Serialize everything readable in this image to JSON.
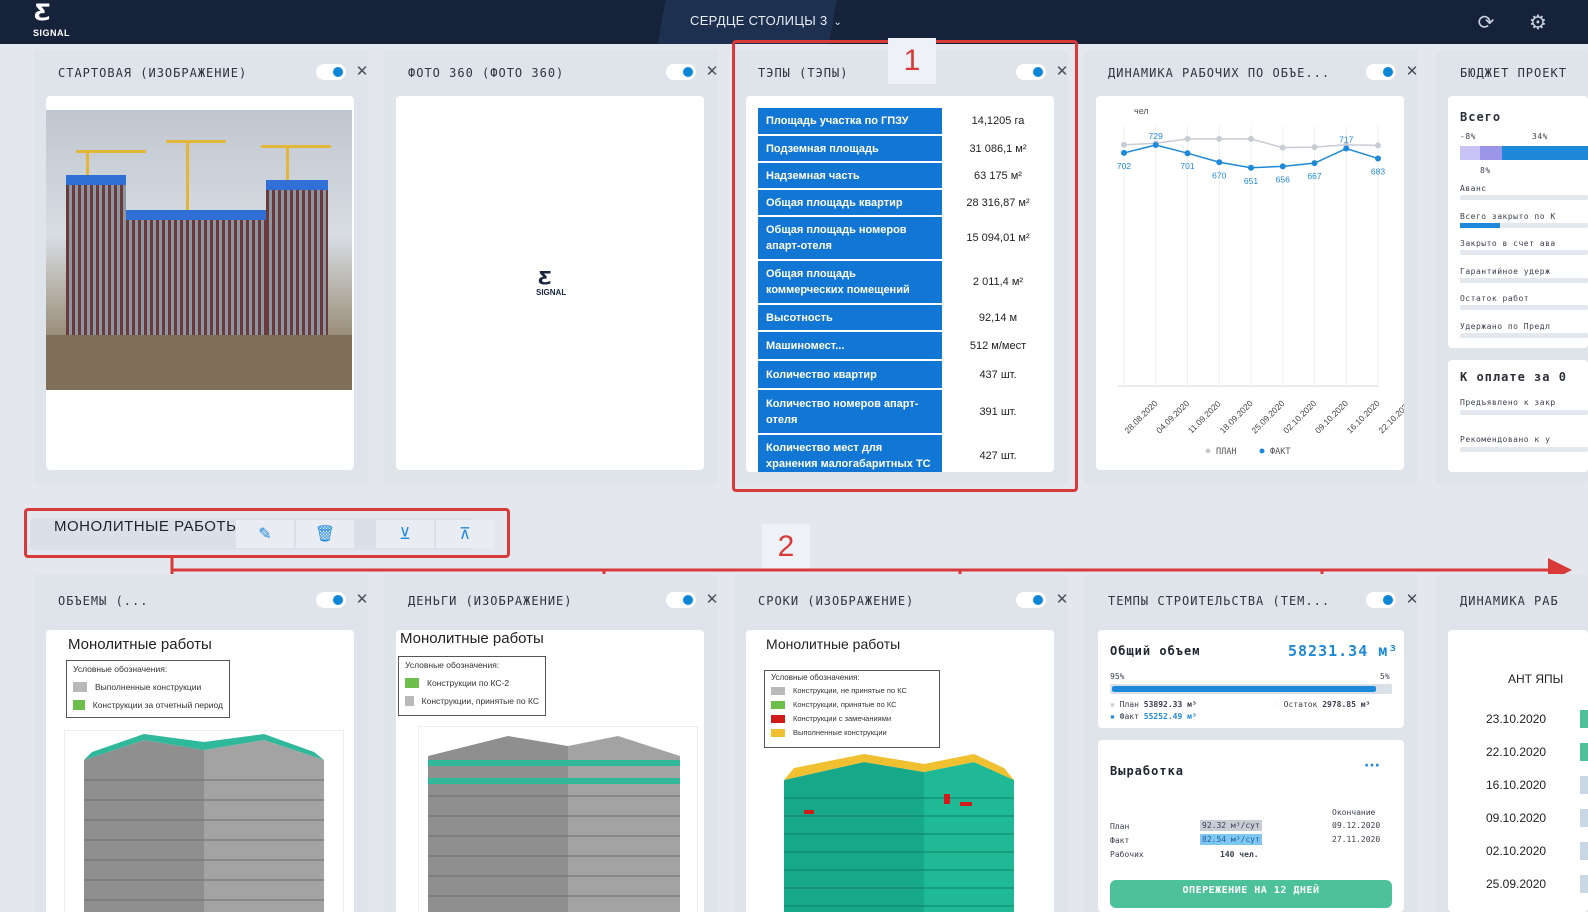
{
  "header": {
    "logo_text": "SIGNAL",
    "project_name": "СЕРДЦЕ СТОЛИЦЫ 3",
    "refresh_icon": "refresh-icon",
    "settings_icon": "gear-icon"
  },
  "widgets_top": [
    {
      "title": "СТАРТОВАЯ (ИЗОБРАЖЕНИЕ)"
    },
    {
      "title": "ФОТО 360 (ФОТО 360)",
      "logo_text": "SIGNAL"
    },
    {
      "title": "ТЭПЫ (ТЭПЫ)"
    },
    {
      "title": "ДИНАМИКА РАБОЧИХ ПО ОБЪЕ..."
    },
    {
      "title": "БЮДЖЕТ ПРОЕКТ"
    }
  ],
  "tep": {
    "rows": [
      {
        "label": "Площадь участка по ГПЗУ",
        "value": "14,1205 га"
      },
      {
        "label": "Подземная площадь",
        "value": "31 086,1 м²"
      },
      {
        "label": "Надземная часть",
        "value": "63 175 м²"
      },
      {
        "label": "Общая площадь квартир",
        "value": "28 316,87 м²"
      },
      {
        "label": "Общая площадь номеров апарт-отеля",
        "value": "15 094,01 м²"
      },
      {
        "label": "Общая площадь коммерческих помещений",
        "value": "2 011,4 м²"
      },
      {
        "label": "Высотность",
        "value": "92,14 м"
      },
      {
        "label": "Машиномест...",
        "value": "512 м/мест"
      },
      {
        "label": "Количество квартир",
        "value": "437 шт."
      },
      {
        "label": "Количество номеров апарт-отеля",
        "value": "391 шт."
      },
      {
        "label": "Количество мест для хранения малогабаритных ТС",
        "value": "427 шт."
      }
    ]
  },
  "chart_data": {
    "type": "line",
    "ylabel": "чел",
    "x": [
      "28.08.2020",
      "04.09.2020",
      "11.09.2020",
      "18.09.2020",
      "25.09.2020",
      "02.10.2020",
      "09.10.2020",
      "16.10.2020",
      "22.10.2020"
    ],
    "series": [
      {
        "name": "ПЛАН",
        "color": "#c8ccd4",
        "values": [
          730,
          735,
          750,
          750,
          750,
          720,
          722,
          730,
          728
        ]
      },
      {
        "name": "ФАКТ",
        "color": "#1f89d9",
        "values": [
          702,
          729,
          701,
          670,
          651,
          656,
          667,
          717,
          683
        ]
      }
    ],
    "data_labels": [
      "702",
      "729",
      "701",
      "670",
      "651",
      "656",
      "667",
      "717",
      "683"
    ],
    "legend": [
      "ПЛАН",
      "ФАКТ"
    ],
    "legend_position": "bottom"
  },
  "budget": {
    "total_label": "Всего",
    "pct_left": "-8%",
    "pct_right": "34%",
    "pct_mid": "8%",
    "lines": [
      "Аванс",
      "Всего закрыто по К",
      "Закрыто в счет ава",
      "Гарантийное удерж",
      "Остаток работ",
      "Удержано по Предл"
    ],
    "to_pay_label": "К оплате за 0",
    "pay_lines": [
      "Предъявлено к закр",
      "Рекомендовано к у"
    ]
  },
  "section": {
    "name": "МОНОЛИТНЫЕ РАБОТЫ",
    "edit_icon": "edit-icon",
    "delete_icon": "trash-icon",
    "down_icon": "arrow-down-circle-icon",
    "up_icon": "arrow-up-circle-icon"
  },
  "annotations": {
    "one": "1",
    "two": "2"
  },
  "widgets_bottom": [
    {
      "title": "ОБЪЕМЫ (...",
      "image_title": "Монолитные работы",
      "legend_caption": "Условные обозначения:",
      "legend": [
        {
          "label": "Выполненные конструкции",
          "color": "#b9b9b9"
        },
        {
          "label": "Конструкции за отчетный период",
          "color": "#6cbf4a"
        }
      ]
    },
    {
      "title": "ДЕНЬГИ (ИЗОБРАЖЕНИЕ)",
      "image_title": "Монолитные работы",
      "legend_caption": "Условные обозначения:",
      "legend": [
        {
          "label": "Конструкции по КС-2",
          "color": "#6cbf4a"
        },
        {
          "label": "Конструкции, принятые по КС",
          "color": "#b9b9b9"
        }
      ]
    },
    {
      "title": "СРОКИ (ИЗОБРАЖЕНИЕ)",
      "image_title": "Монолитные работы",
      "legend_caption": "Условные обозначения:",
      "legend": [
        {
          "label": "Конструкции, не принятые по КС",
          "color": "#b9b9b9"
        },
        {
          "label": "Конструкции, принятые по КС",
          "color": "#6cbf4a"
        },
        {
          "label": "Конструкции с замечаниями",
          "color": "#d11a1a"
        },
        {
          "label": "Выполненные конструкции",
          "color": "#f0c030"
        }
      ]
    },
    {
      "title": "ТЕМПЫ СТРОИТЕЛЬСТВА (ТЕМ...",
      "total_label": "Общий объем",
      "total_value": "58231.34 м³",
      "pct_left": "95%",
      "pct_right": "5%",
      "progress": 0.95,
      "plan_label": "План",
      "plan_value": "53892.33 м³",
      "fact_label": "Факт",
      "fact_value": "55252.49 м³",
      "rest_label": "Остаток",
      "rest_value": "2978.85 м³",
      "output_title": "Выработка",
      "more_icon": "ellipsis-icon",
      "end_header": "Окончание",
      "rows": [
        {
          "label": "План",
          "rate": "92.32 м³/сут",
          "end": "09.12.2020"
        },
        {
          "label": "Факт",
          "rate": "82.54 м³/сут",
          "end": "27.11.2020"
        },
        {
          "label": "Рабочих",
          "rate": "140 чел.",
          "end": ""
        }
      ],
      "ahead_label": "ОПЕРЕЖЕНИЕ НА 12 ДНЕЙ"
    },
    {
      "title": "ДИНАМИКА РАБ",
      "column_label": "АНТ ЯПЫ",
      "dates": [
        "23.10.2020",
        "22.10.2020",
        "16.10.2020",
        "09.10.2020",
        "02.10.2020",
        "25.09.2020"
      ]
    }
  ]
}
